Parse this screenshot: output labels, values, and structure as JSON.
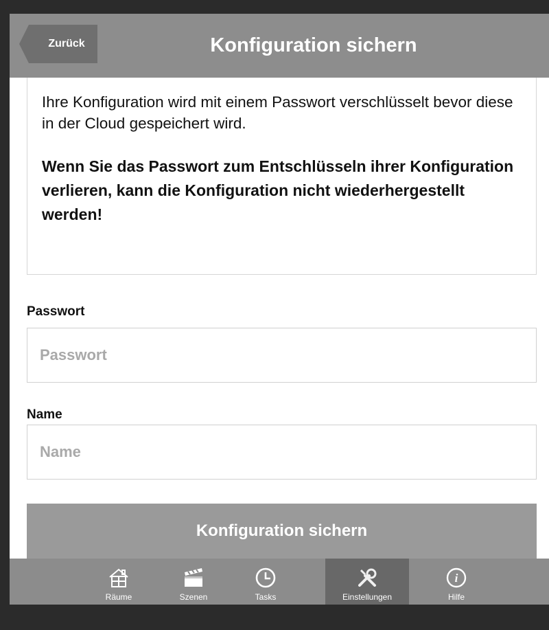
{
  "header": {
    "back_label": "Zurück",
    "title": "Konfiguration sichern"
  },
  "info": {
    "paragraph": "Ihre Konfiguration wird mit einem Passwort verschlüsselt bevor diese in der Cloud gespeichert wird.",
    "warning": "Wenn Sie das Passwort zum Entschlüsseln ihrer Konfiguration verlieren, kann die Konfiguration nicht wiederhergestellt werden!"
  },
  "form": {
    "password_label": "Passwort",
    "password_placeholder": "Passwort",
    "password_value": "",
    "name_label": "Name",
    "name_placeholder": "Name",
    "name_value": "",
    "submit_label": "Konfiguration sichern"
  },
  "tabbar": {
    "active": "Einstellungen",
    "items": [
      {
        "label": "Räume",
        "icon": "house-icon"
      },
      {
        "label": "Szenen",
        "icon": "clapperboard-icon"
      },
      {
        "label": "Tasks",
        "icon": "clock-icon"
      },
      {
        "label": "Einstellungen",
        "icon": "tools-icon"
      },
      {
        "label": "Hilfe",
        "icon": "info-icon"
      }
    ]
  },
  "colors": {
    "header_bg": "#8d8d8d",
    "back_button_bg": "#6f6f6f",
    "submit_button_bg": "#9a9a9a",
    "tabbar_bg": "#8c8c8c",
    "tab_active_bg": "#686868"
  }
}
